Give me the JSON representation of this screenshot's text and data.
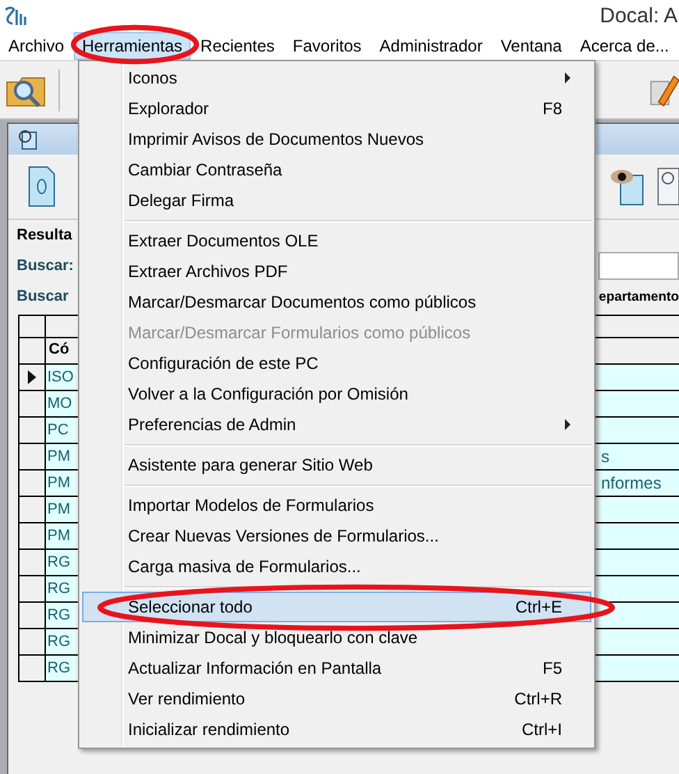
{
  "window": {
    "title": "Docal: A"
  },
  "menubar": [
    {
      "label": "Archivo",
      "selected": false
    },
    {
      "label": "Herramientas",
      "selected": true
    },
    {
      "label": "Recientes",
      "selected": false
    },
    {
      "label": "Favoritos",
      "selected": false
    },
    {
      "label": "Administrador",
      "selected": false
    },
    {
      "label": "Ventana",
      "selected": false
    },
    {
      "label": "Acerca de...",
      "selected": false
    }
  ],
  "document_window": {
    "tab": "Resulta",
    "search_label": "Buscar:",
    "search_in_label": "Buscar",
    "column_header": "Có",
    "right_header": "epartamento",
    "rows": [
      {
        "code": "ISO",
        "current": true
      },
      {
        "code": "MO",
        "current": false
      },
      {
        "code": "PC",
        "current": false
      },
      {
        "code": "PM",
        "current": false,
        "right": "s"
      },
      {
        "code": "PM",
        "current": false,
        "right": "nformes"
      },
      {
        "code": "PM",
        "current": false
      },
      {
        "code": "PM",
        "current": false
      },
      {
        "code": "RG",
        "current": false
      },
      {
        "code": "RG",
        "current": false
      },
      {
        "code": "RG",
        "current": false
      },
      {
        "code": "RG",
        "current": false
      },
      {
        "code": "RG",
        "current": false
      }
    ]
  },
  "menu": {
    "items": [
      {
        "kind": "item",
        "label": "Iconos",
        "submenu": true,
        "disabled": false,
        "selected": false
      },
      {
        "kind": "item",
        "label": "Explorador",
        "shortcut": "F8",
        "submenu": false,
        "disabled": false,
        "selected": false
      },
      {
        "kind": "item",
        "label": "Imprimir Avisos de Documentos Nuevos",
        "submenu": false,
        "disabled": false,
        "selected": false
      },
      {
        "kind": "item",
        "label": "Cambiar Contraseña",
        "submenu": false,
        "disabled": false,
        "selected": false
      },
      {
        "kind": "item",
        "label": "Delegar Firma",
        "submenu": false,
        "disabled": false,
        "selected": false
      },
      {
        "kind": "separator"
      },
      {
        "kind": "item",
        "label": "Extraer Documentos OLE",
        "submenu": false,
        "disabled": false,
        "selected": false
      },
      {
        "kind": "item",
        "label": "Extraer Archivos PDF",
        "submenu": false,
        "disabled": false,
        "selected": false
      },
      {
        "kind": "item",
        "label": "Marcar/Desmarcar Documentos como públicos",
        "submenu": false,
        "disabled": false,
        "selected": false
      },
      {
        "kind": "item",
        "label": "Marcar/Desmarcar Formularios como públicos",
        "submenu": false,
        "disabled": true,
        "selected": false
      },
      {
        "kind": "item",
        "label": "Configuración de este PC",
        "submenu": false,
        "disabled": false,
        "selected": false
      },
      {
        "kind": "item",
        "label": "Volver a la Configuración por Omisión",
        "submenu": false,
        "disabled": false,
        "selected": false
      },
      {
        "kind": "item",
        "label": "Preferencias de Admin",
        "submenu": true,
        "disabled": false,
        "selected": false
      },
      {
        "kind": "separator"
      },
      {
        "kind": "item",
        "label": "Asistente para generar Sitio Web",
        "submenu": false,
        "disabled": false,
        "selected": false
      },
      {
        "kind": "separator"
      },
      {
        "kind": "item",
        "label": "Importar Modelos de Formularios",
        "submenu": false,
        "disabled": false,
        "selected": false
      },
      {
        "kind": "item",
        "label": "Crear Nuevas Versiones de Formularios...",
        "submenu": false,
        "disabled": false,
        "selected": false
      },
      {
        "kind": "item",
        "label": "Carga masiva de Formularios...",
        "submenu": false,
        "disabled": false,
        "selected": false
      },
      {
        "kind": "separator"
      },
      {
        "kind": "item",
        "label": "Seleccionar todo",
        "shortcut": "Ctrl+E",
        "submenu": false,
        "disabled": false,
        "selected": true
      },
      {
        "kind": "item",
        "label": "Minimizar Docal y bloquearlo con clave",
        "submenu": false,
        "disabled": false,
        "selected": false
      },
      {
        "kind": "item",
        "label": "Actualizar Información en Pantalla",
        "shortcut": "F5",
        "submenu": false,
        "disabled": false,
        "selected": false
      },
      {
        "kind": "item",
        "label": "Ver rendimiento",
        "shortcut": "Ctrl+R",
        "submenu": false,
        "disabled": false,
        "selected": false
      },
      {
        "kind": "item",
        "label": "Inicializar rendimiento",
        "shortcut": "Ctrl+I",
        "submenu": false,
        "disabled": false,
        "selected": false
      }
    ]
  }
}
